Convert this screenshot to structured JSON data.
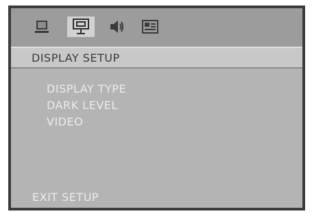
{
  "tabs": [
    {
      "icon": "general-setup-icon",
      "selected": false
    },
    {
      "icon": "display-setup-icon",
      "selected": true
    },
    {
      "icon": "audio-setup-icon",
      "selected": false
    },
    {
      "icon": "preferences-icon",
      "selected": false
    }
  ],
  "title": "DISPLAY SETUP",
  "items": [
    {
      "label": "DISPLAY TYPE"
    },
    {
      "label": "DARK LEVEL"
    },
    {
      "label": "VIDEO"
    }
  ],
  "exit_label": "EXIT SETUP",
  "colors": {
    "frame": "#3c3c3c",
    "icon_bar": "#9c9c9c",
    "title_bar": "#c8c8c8",
    "body": "#b4b4b4",
    "item_text": "#ececec",
    "title_text": "#3a3a3a"
  }
}
